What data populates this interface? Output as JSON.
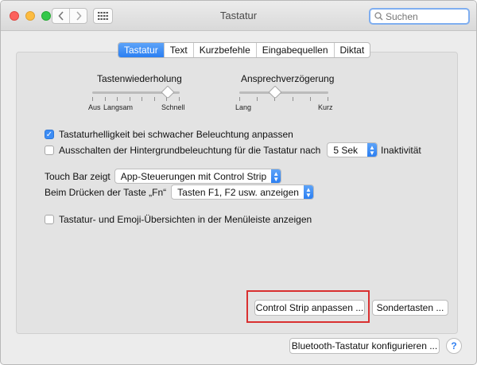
{
  "window": {
    "title": "Tastatur"
  },
  "titlebar": {
    "back_icon": "chevron-left",
    "forward_icon": "chevron-right",
    "grid_icon": "grid",
    "search_placeholder": "Suchen"
  },
  "tabs": [
    {
      "label": "Tastatur",
      "selected": true
    },
    {
      "label": "Text",
      "selected": false
    },
    {
      "label": "Kurzbefehle",
      "selected": false
    },
    {
      "label": "Eingabequellen",
      "selected": false
    },
    {
      "label": "Diktat",
      "selected": false
    }
  ],
  "sliders": {
    "repeat": {
      "title": "Tastenwiederholung",
      "min_label": "Aus",
      "low_label": "Langsam",
      "max_label": "Schnell",
      "ticks": 8,
      "value_fraction": 0.86
    },
    "delay": {
      "title": "Ansprechverzögerung",
      "min_label": "Lang",
      "max_label": "Kurz",
      "ticks": 6,
      "value_fraction": 0.4
    }
  },
  "options": {
    "brightness_label": "Tastaturhelligkeit bei schwacher Beleuchtung anpassen",
    "brightness_checked": true,
    "backlight_label": "Ausschalten der Hintergrundbeleuchtung für die Tastatur nach",
    "backlight_checked": false,
    "backlight_value": "5 Sek",
    "backlight_suffix": "Inaktivität",
    "touchbar_label": "Touch Bar zeigt",
    "touchbar_value": "App-Steuerungen mit Control Strip",
    "fn_label": "Beim Drücken der Taste „Fn“",
    "fn_value": "Tasten F1, F2 usw. anzeigen",
    "menubar_label": "Tastatur- und Emoji-Übersichten in der Menüleiste anzeigen",
    "menubar_checked": false
  },
  "buttons": {
    "control_strip": "Control Strip anpassen ...",
    "modifier_keys": "Sondertasten ...",
    "bluetooth": "Bluetooth-Tastatur konfigurieren ...",
    "help": "?"
  },
  "colors": {
    "accent": "#2b7ff2",
    "highlight": "#d93030"
  }
}
